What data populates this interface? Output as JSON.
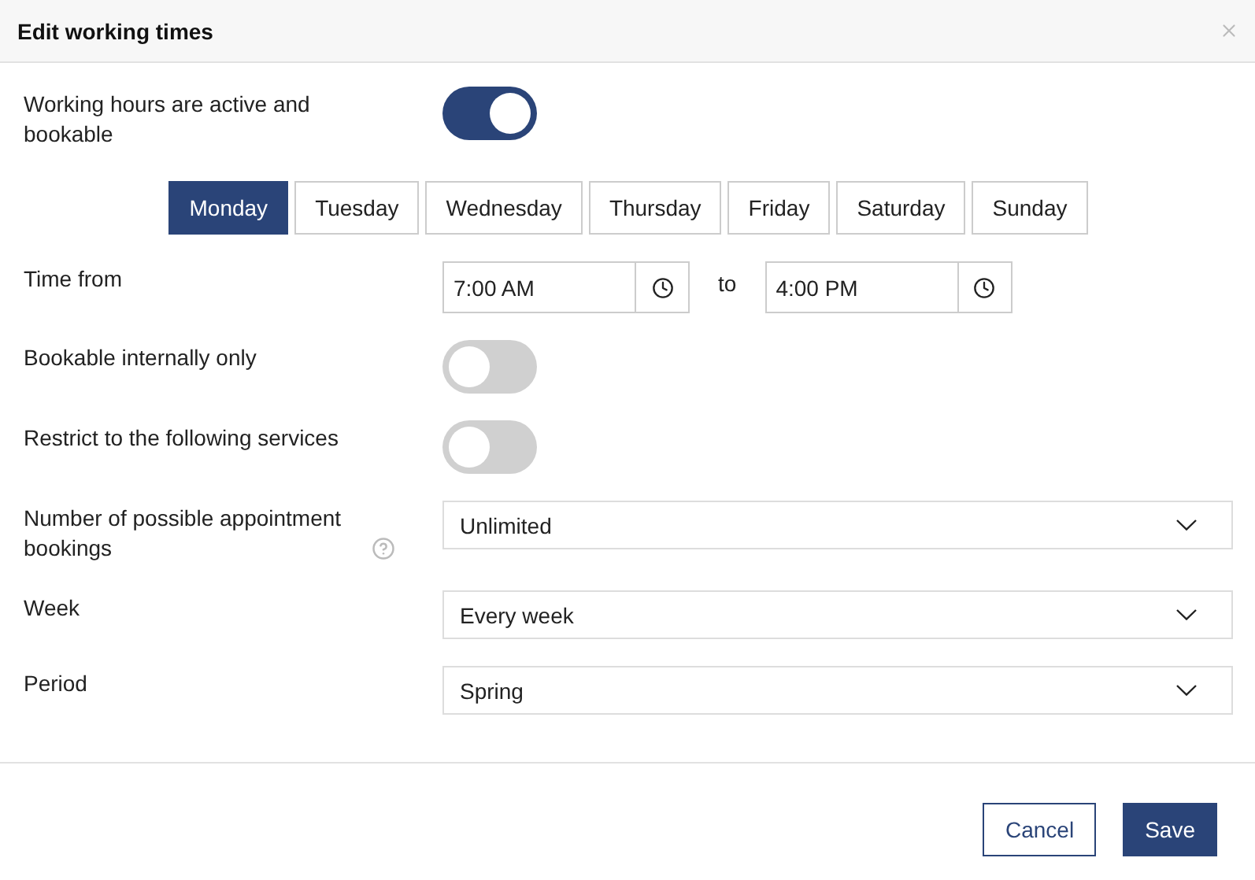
{
  "dialog": {
    "title": "Edit working times"
  },
  "rows": [
    {
      "kind": "toggle",
      "label": "Working hours are active and bookable",
      "on": true
    },
    {
      "kind": "days",
      "days": [
        {
          "label": "Monday",
          "selected": true
        },
        {
          "label": "Tuesday",
          "selected": false
        },
        {
          "label": "Wednesday",
          "selected": false
        },
        {
          "label": "Thursday",
          "selected": false
        },
        {
          "label": "Friday",
          "selected": false
        },
        {
          "label": "Saturday",
          "selected": false
        },
        {
          "label": "Sunday",
          "selected": false
        }
      ]
    },
    {
      "kind": "timerange",
      "label": "Time from",
      "from": "7:00 AM",
      "separator": "to",
      "to": "4:00 PM"
    },
    {
      "kind": "toggle",
      "label": "Bookable internally only",
      "on": false
    },
    {
      "kind": "toggle",
      "label": "Restrict to the following services",
      "on": false
    },
    {
      "kind": "select",
      "label": "Number of possible appointment bookings",
      "help": true,
      "value": "Unlimited"
    },
    {
      "kind": "select",
      "label": "Week",
      "value": "Every week"
    },
    {
      "kind": "select",
      "label": "Period",
      "value": "Spring"
    }
  ],
  "buttons": [
    {
      "label": "Cancel",
      "kind": "secondary"
    },
    {
      "label": "Save",
      "kind": "primary"
    }
  ]
}
